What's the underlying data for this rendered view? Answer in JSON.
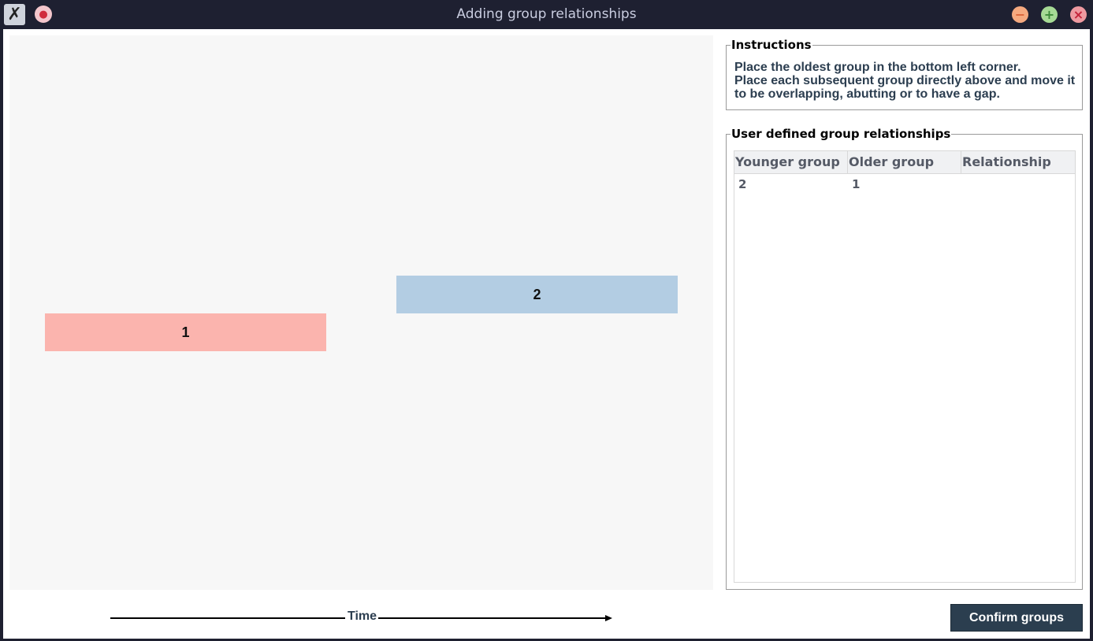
{
  "window": {
    "title": "Adding group relationships",
    "app_icon": "tk-feather-icon",
    "pin_icon": "pin-icon"
  },
  "canvas": {
    "groups": [
      {
        "label": "1",
        "color": "#fbb4ae"
      },
      {
        "label": "2",
        "color": "#b3cde3"
      }
    ],
    "axis_label": "Time"
  },
  "instructions": {
    "legend": "Instructions",
    "lines": [
      "Place the oldest group in the bottom left corner.",
      "Place each subsequent group directly above and move it",
      "to be overlapping, abutting or to have a gap."
    ]
  },
  "relationships": {
    "legend": "User defined group relationships",
    "columns": [
      "Younger group",
      "Older group",
      "Relationship"
    ],
    "rows": [
      [
        "2",
        "1",
        ""
      ]
    ]
  },
  "actions": {
    "confirm_label": "Confirm groups"
  },
  "colors": {
    "titlebar": "#1e2031",
    "confirm_button": "#2b3e4f"
  }
}
